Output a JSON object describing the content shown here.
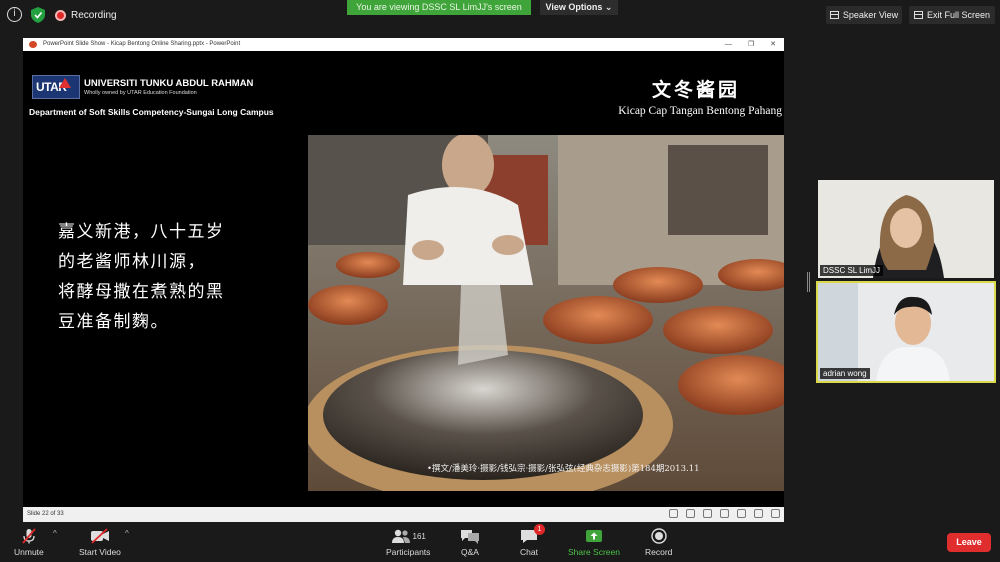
{
  "topbar": {
    "recording_label": "Recording",
    "viewing_banner": "You are viewing DSSC SL LimJJ's screen",
    "view_options_label": "View Options",
    "speaker_view_label": "Speaker View",
    "exit_full_screen_label": "Exit Full Screen"
  },
  "powerpoint": {
    "window_title": "PowerPoint Slide Show  -  Kicap Bentong Online Sharing.pptx  -  PowerPoint",
    "status_text": "Slide 22 of 33"
  },
  "slide": {
    "university_name": "UNIVERSITI TUNKU ABDUL RAHMAN",
    "university_sub": "Wholly owned by UTAR Education Foundation",
    "logo_text": "UTAR",
    "department": "Department of Soft Skills Competency-Sungai Long Campus",
    "cn_title": "文冬酱园",
    "brand_title": "Kicap Cap Tangan Bentong Pahang",
    "body_lines": [
      "嘉义新港，八十五岁",
      "的老酱师林川源，",
      "将酵母撒在煮熟的黑",
      "豆准备制麴。"
    ],
    "photo_credit": "•撰文/潘美玲·摄影/钱弘宗·摄影/张弘弦(经典杂志摄影)第184期2013.11"
  },
  "participants_tiles": [
    {
      "name": "DSSC SL LimJJ"
    },
    {
      "name": "adrian wong"
    }
  ],
  "toolbar": {
    "unmute_label": "Unmute",
    "start_video_label": "Start Video",
    "participants_label": "Participants",
    "participants_count": "161",
    "qa_label": "Q&A",
    "chat_label": "Chat",
    "chat_badge": "1",
    "share_screen_label": "Share Screen",
    "record_label": "Record",
    "leave_label": "Leave"
  },
  "colors": {
    "share_green": "#3fa53a",
    "leave_red": "#e02d2d",
    "active_speaker_border": "#d9d94a"
  }
}
